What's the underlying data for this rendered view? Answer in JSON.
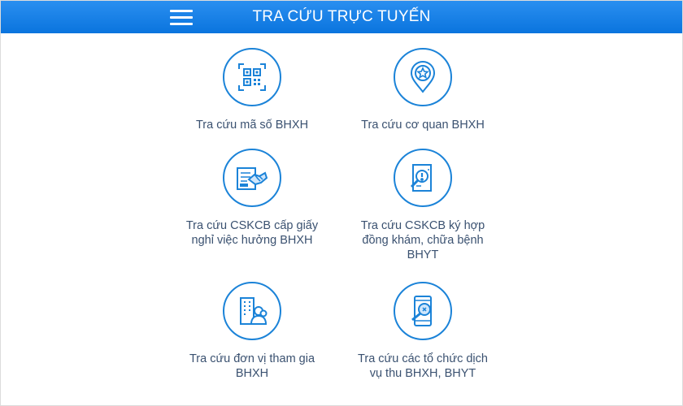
{
  "header": {
    "title": "TRA CỨU TRỰC TUYẾN",
    "menu_icon": "hamburger-menu-icon"
  },
  "colors": {
    "header_bg": "#0a74de",
    "icon_stroke": "#1b83d8",
    "label_text": "#3a5170"
  },
  "items": [
    {
      "label": "Tra cứu mã số BHXH",
      "icon": "qr-code-icon"
    },
    {
      "label": "Tra cứu cơ quan BHXH",
      "icon": "location-star-pin-icon"
    },
    {
      "label": "Tra cứu CSKCB cấp giấy\nnghỉ việc hưởng BHXH",
      "icon": "handshake-document-icon"
    },
    {
      "label": "Tra cứu CSKCB ký hợp\nđồng khám, chữa bệnh\nBHYT",
      "icon": "document-search-icon"
    },
    {
      "label": "Tra cứu đơn vị tham gia\nBHXH",
      "icon": "building-users-icon"
    },
    {
      "label": "Tra cứu các tổ chức dịch\nvụ thu BHXH, BHYT",
      "icon": "phone-search-icon"
    }
  ]
}
